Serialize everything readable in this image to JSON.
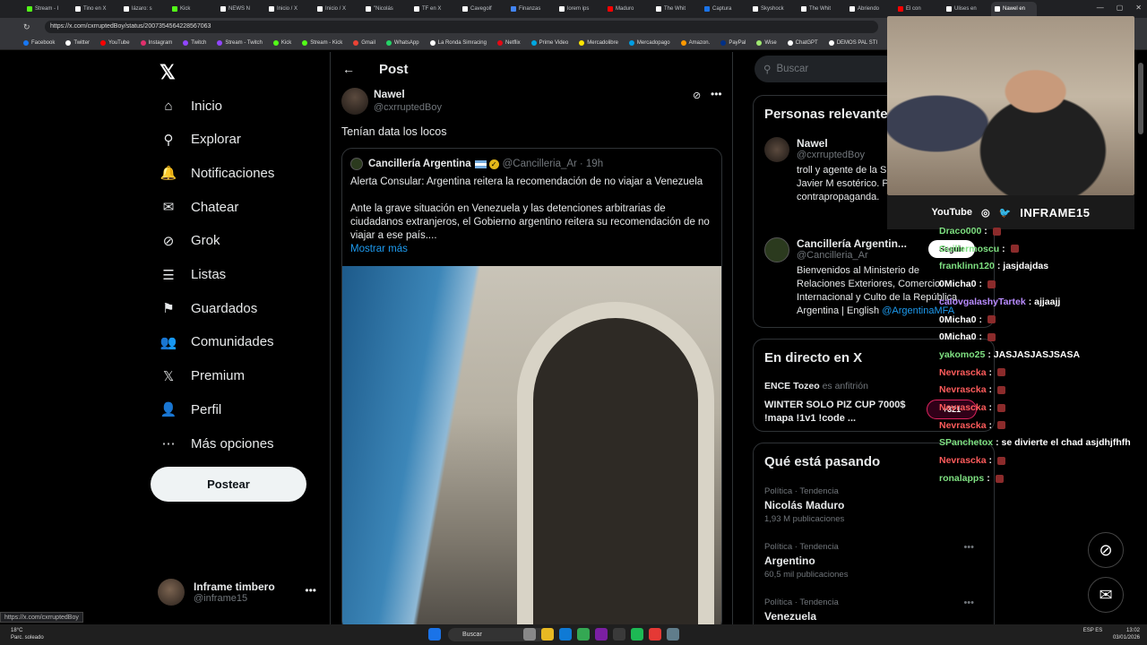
{
  "browser": {
    "tabs": [
      {
        "label": "Stream - I",
        "color": "#53fc18"
      },
      {
        "label": "Tino en X",
        "color": "#ffffff"
      },
      {
        "label": "lázaro: s",
        "color": "#ffffff"
      },
      {
        "label": "Kick",
        "color": "#53fc18"
      },
      {
        "label": "NEWS N",
        "color": "#ffffff"
      },
      {
        "label": "Inicio / X",
        "color": "#ffffff"
      },
      {
        "label": "Inicio / X",
        "color": "#ffffff"
      },
      {
        "label": "\"Nicolás",
        "color": "#ffffff"
      },
      {
        "label": "TF en X",
        "color": "#ffffff"
      },
      {
        "label": "Cavegolf",
        "color": "#ffffff"
      },
      {
        "label": "Finanzas",
        "color": "#4285f4"
      },
      {
        "label": "lorem ips",
        "color": "#ffffff"
      },
      {
        "label": "Maduro",
        "color": "#ff0000"
      },
      {
        "label": "The Whit",
        "color": "#ffffff"
      },
      {
        "label": "Captura",
        "color": "#1a73e8"
      },
      {
        "label": "Skyshock",
        "color": "#ffffff"
      },
      {
        "label": "The Whit",
        "color": "#ffffff"
      },
      {
        "label": "Abriendo",
        "color": "#ffffff"
      },
      {
        "label": "El con",
        "color": "#ff0000"
      },
      {
        "label": "Ulises en",
        "color": "#ffffff"
      },
      {
        "label": "Nawel en",
        "color": "#ffffff",
        "active": true
      }
    ],
    "url": "https://x.com/cxrruptedBoy/status/2007354564228567063",
    "bookmarks": [
      {
        "label": "Facebook",
        "color": "#1877f2"
      },
      {
        "label": "Twitter",
        "color": "#ffffff"
      },
      {
        "label": "YouTube",
        "color": "#ff0000"
      },
      {
        "label": "Instagram",
        "color": "#e1306c"
      },
      {
        "label": "Twitch",
        "color": "#9146ff"
      },
      {
        "label": "Stream - Twitch",
        "color": "#9146ff"
      },
      {
        "label": "Kick",
        "color": "#53fc18"
      },
      {
        "label": "Stream - Kick",
        "color": "#53fc18"
      },
      {
        "label": "Gmail",
        "color": "#ea4335"
      },
      {
        "label": "WhatsApp",
        "color": "#25d366"
      },
      {
        "label": "La Ronda Simracing",
        "color": "#ffffff"
      },
      {
        "label": "Netflix",
        "color": "#e50914"
      },
      {
        "label": "Prime Video",
        "color": "#00a8e1"
      },
      {
        "label": "Mercadolibre",
        "color": "#ffe600"
      },
      {
        "label": "Mercadopago",
        "color": "#009ee3"
      },
      {
        "label": "Amazon.",
        "color": "#ff9900"
      },
      {
        "label": "PayPal",
        "color": "#003087"
      },
      {
        "label": "Wise",
        "color": "#9fe870"
      },
      {
        "label": "ChatGPT",
        "color": "#ffffff"
      },
      {
        "label": "DEMOS PAL STI",
        "color": "#ffffff"
      }
    ],
    "status_url": "https://x.com/cxrruptedBoy"
  },
  "nav": {
    "items": [
      {
        "label": "Inicio",
        "icon": "home-icon",
        "glyph": "⌂"
      },
      {
        "label": "Explorar",
        "icon": "search-icon",
        "glyph": "⚲"
      },
      {
        "label": "Notificaciones",
        "icon": "bell-icon",
        "glyph": "🔔"
      },
      {
        "label": "Chatear",
        "icon": "mail-icon",
        "glyph": "✉"
      },
      {
        "label": "Grok",
        "icon": "grok-icon",
        "glyph": "⊘"
      },
      {
        "label": "Listas",
        "icon": "list-icon",
        "glyph": "☰"
      },
      {
        "label": "Guardados",
        "icon": "bookmark-icon",
        "glyph": "⚑"
      },
      {
        "label": "Comunidades",
        "icon": "communities-icon",
        "glyph": "👥"
      },
      {
        "label": "Premium",
        "icon": "x-premium-icon",
        "glyph": "𝕏"
      },
      {
        "label": "Perfil",
        "icon": "profile-icon",
        "glyph": "👤"
      },
      {
        "label": "Más opciones",
        "icon": "more-circle-icon",
        "glyph": "⋯"
      }
    ],
    "post_button": "Postear",
    "account": {
      "name": "Inframe timbero",
      "handle": "@inframe15"
    }
  },
  "post": {
    "title": "Post",
    "author_name": "Nawel",
    "author_handle": "@cxrruptedBoy",
    "text": "Tenían data los locos",
    "quote": {
      "name": "Cancillería Argentina",
      "handle": "@Cancilleria_Ar",
      "time": "· 19h",
      "line1": "Alerta Consular: Argentina reitera la recomendación de no viajar a Venezuela",
      "line2": "Ante la grave situación en Venezuela y las detenciones arbitrarias de ciudadanos extranjeros, el Gobierno argentino reitera su recomendación de no viajar a ese país....",
      "more": "Mostrar más"
    }
  },
  "right": {
    "search_placeholder": "Buscar",
    "relevant_title": "Personas relevantes",
    "people": [
      {
        "name": "Nawel",
        "handle": "@cxrruptedBoy",
        "bio": "troll y agente de la S gobierno de Javier M esotérico. Propagan contrapropaganda."
      },
      {
        "name": "Cancillería Argentin...",
        "handle": "@Cancilleria_Ar",
        "bio": "Bienvenidos al Ministerio de Relaciones Exteriores, Comercio Internacional y Culto de la República Argentina | English",
        "link": "@ArgentinaMFA"
      }
    ],
    "live_title": "En directo en X",
    "live_host": "ENCE Tozeo",
    "live_host_role": "es anfitrión",
    "live_text": "WINTER SOLO PIZ CUP 7000$ !mapa !1v1 !code ...",
    "trending_title": "Qué está pasando",
    "trends": [
      {
        "category": "Política · Tendencia",
        "title": "Nicolás Maduro",
        "count": "1,93 M publicaciones"
      },
      {
        "category": "Política · Tendencia",
        "title": "Argentino",
        "count": "60,5 mil publicaciones"
      },
      {
        "category": "Política · Tendencia",
        "title": "Venezuela",
        "count": ""
      }
    ]
  },
  "stream": {
    "brands": [
      "YouTube",
      "◎",
      "🐦",
      "INFRAME15"
    ],
    "chat": [
      {
        "user": "Draco000",
        "msg": "",
        "color": "#7ee081"
      },
      {
        "user": "Guillermoscu",
        "msg": "",
        "color": "#7ee081"
      },
      {
        "user": "franklinn120",
        "msg": "jasjdajdas",
        "color": "#7ee081"
      },
      {
        "user": "0Micha0",
        "msg": "",
        "color": "#ffffff"
      },
      {
        "user": "calovgalashyTartek",
        "msg": "ajjaajj",
        "color": "#b98cff"
      },
      {
        "user": "0Micha0",
        "msg": "",
        "color": "#ffffff"
      },
      {
        "user": "0Micha0",
        "msg": "",
        "color": "#ffffff"
      },
      {
        "user": "yakomo25",
        "msg": "JASJASJASJSASA",
        "color": "#7ee081"
      },
      {
        "user": "Nevrascka",
        "msg": "",
        "color": "#ff5c5c"
      },
      {
        "user": "Nevrascka",
        "msg": "",
        "color": "#ff5c5c"
      },
      {
        "user": "Nevrascka",
        "msg": "",
        "color": "#ff5c5c"
      },
      {
        "user": "Nevrascka",
        "msg": "",
        "color": "#ff5c5c"
      },
      {
        "user": "SPanchetox",
        "msg": "se divierte el chad asjdhjfhfh",
        "color": "#7ee081"
      },
      {
        "user": "Nevrascka",
        "msg": "",
        "color": "#ff5c5c"
      },
      {
        "user": "ronalapps",
        "msg": "",
        "color": "#7ee081"
      }
    ],
    "badge": "+321",
    "pill": "Seguir"
  },
  "taskbar": {
    "weather_temp": "18°C",
    "weather_desc": "Parc. soleado",
    "search": "Buscar",
    "lang": "ESP ES",
    "time": "13:02",
    "date": "03/01/2026"
  }
}
